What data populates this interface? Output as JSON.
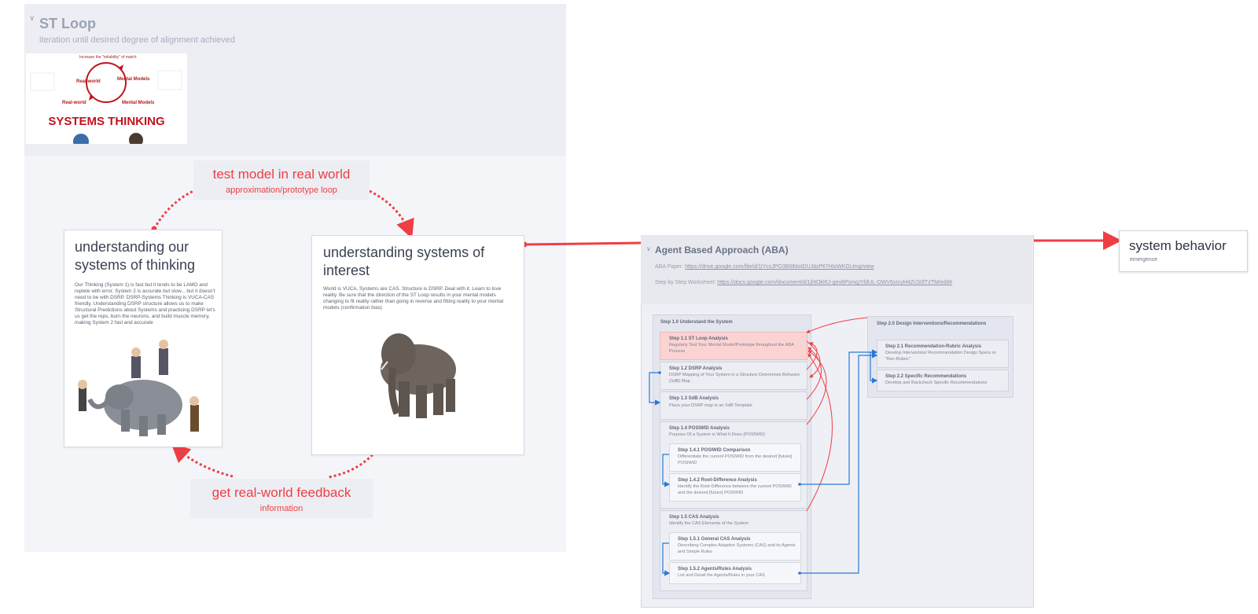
{
  "st_loop": {
    "title": "ST Loop",
    "subtitle": "iteration until desired degree of alignment achieved",
    "thumbnail": {
      "banner": "SYSTEMS THINKING",
      "top_caption": "Increase the \"reliability\" of match",
      "left_node": "Real-world",
      "right_node": "Mental Models",
      "left_caption": "Real-world",
      "right_caption": "Mental Models"
    },
    "test_label": {
      "main": "test model in real world",
      "sub": "approximation/prototype loop"
    },
    "feedback_label": {
      "main": "get real-world feedback",
      "sub": "information"
    }
  },
  "card_thinking": {
    "title": "understanding our systems of thinking",
    "body": "Our Thinking (System 1) is fast but it tends to be LAMO and replete with error. System 2 is accurate but slow... but it doesn't need to be with DSRP. DSRP-Systems Thinking is VUCA-CAS friendly. Understanding DSRP structure allows us to make Structural Predictions about Systems and practicing DSRP let's us get the reps, burn the neurons, and build muscle memory, making System 2 fast and accurate"
  },
  "card_interest": {
    "title": "understanding systems of interest",
    "body": "World is VUCA, Systems are CAS. Structure is DSRP. Deal with it. Learn to love reality. Be sure that the direction of the ST Loop  results in your mental models changing to fit reality rather than going in reverse and fitting reality to your mental models (confirmation bias)"
  },
  "aba": {
    "title": "Agent Based Approach (ABA)",
    "paper_label": "ABA Paper:",
    "paper_link": "https://drive.google.com/file/d/1lYcsJPO3B6lMoIDUJdzPtl7HloWKGUmg/view",
    "worksheet_label": "Step by Step Worksheet:",
    "worksheet_link": "https://docs.google.com/document/d/1jhtOkI6J-geo6Psmg7rfdUL-OWV6xrcyH4ZcS0fTzTM/edit#",
    "step1": {
      "title": "Step 1.0 Understand the System",
      "s11": {
        "title": "Step 1.1 ST Loop Analysis",
        "desc": "Regularly Test Your Mental Model/Prototype throughout the ABA Process"
      },
      "s12": {
        "title": "Step 1.2 DSRP Analysis",
        "desc": "DSRP Mapping of Your System in a Structure Determines Behavior (SdB) Map"
      },
      "s13": {
        "title": "Step 1.3 SdB Analysis",
        "desc": "Place your DSRP map in an SdB Template"
      },
      "s14": {
        "title": "Step 1.4 POSIWID Analysis",
        "desc": "Purpose Of a System is What It Does (POSIWID)"
      },
      "s141": {
        "title": "Step 1.4.1 POSIWID Comparison",
        "desc": "Differentiate the current POSIWID from the desired [future] POSIWID"
      },
      "s142": {
        "title": "Step 1.4.2 Root-Difference Analysis",
        "desc": "Identify the Root-Difference between the current POSIWID and the desired [future] POSIWID"
      },
      "s15": {
        "title": "Step 1.5 CAS Analysis",
        "desc": "Identify the CAS Elements of the System"
      },
      "s151": {
        "title": "Step 1.5.1 General CAS Analysis",
        "desc": "Describing Complex Adaptive Systems (CAS) and its Agents and Simple Rules"
      },
      "s152": {
        "title": "Step 1.5.2  Agents/Rules Analysis",
        "desc": "List and Detail the Agents/Rules in your CAS"
      }
    },
    "step2": {
      "title": "Step 2.0 Design Interventions/Recommendations",
      "s21": {
        "title": "Step 2.1 Recommendation-Rubric Analysis",
        "desc": "Develop Intervention/ Recommendation Design Specs or \"Rec-Rubric\""
      },
      "s22": {
        "title": "Step 2.2 Specific Recommendations",
        "desc": "Develop and Backcheck Specific Recommendations"
      }
    }
  },
  "system_behavior": {
    "title": "system behavior",
    "sub": "emergence"
  },
  "colors": {
    "accent_red": "#ee3f44",
    "connector_blue": "#2a78d8",
    "highlight_pink": "#fbd3d3"
  }
}
